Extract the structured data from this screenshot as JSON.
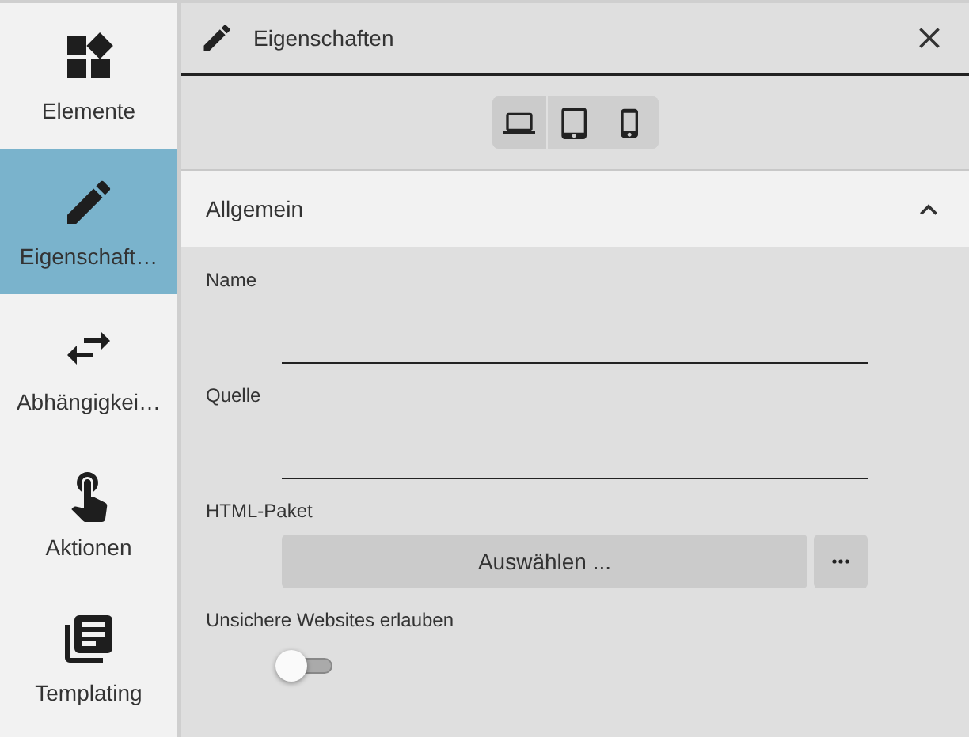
{
  "sidebar": {
    "items": [
      {
        "kind": "widgets",
        "label": "Elemente",
        "selected": false
      },
      {
        "kind": "pencil",
        "label": "Eigenschaft…",
        "selected": true
      },
      {
        "kind": "swap",
        "label": "Abhängigkei…",
        "selected": false
      },
      {
        "kind": "touch",
        "label": "Aktionen",
        "selected": false
      },
      {
        "kind": "library",
        "label": "Templating",
        "selected": false
      }
    ]
  },
  "panel": {
    "title": "Eigenschaften",
    "devices": [
      {
        "kind": "laptop",
        "selected": true
      },
      {
        "kind": "tablet",
        "selected": false
      },
      {
        "kind": "phone",
        "selected": false
      }
    ],
    "section": {
      "title": "Allgemein",
      "expanded": true,
      "fields": [
        {
          "kind": "text",
          "label": "Name"
        },
        {
          "kind": "text",
          "label": "Quelle"
        },
        {
          "kind": "picker",
          "label": "HTML-Paket",
          "button": "Auswählen ..."
        },
        {
          "kind": "toggle",
          "label": "Unsichere Websites erlauben",
          "on": false
        }
      ]
    }
  }
}
